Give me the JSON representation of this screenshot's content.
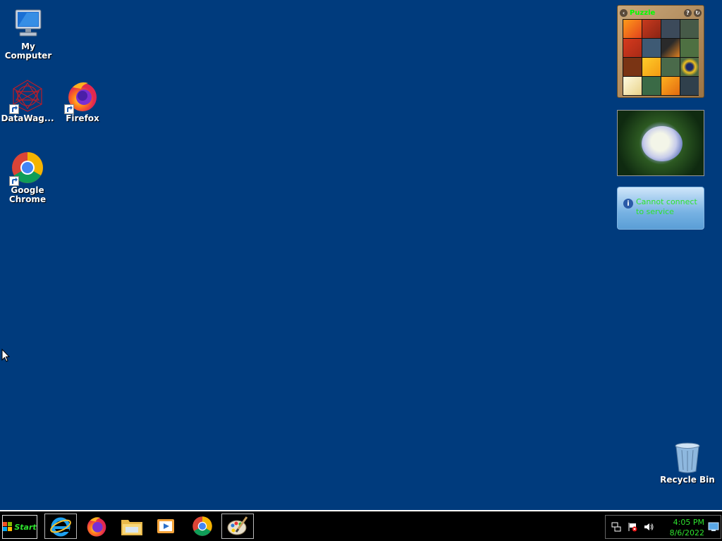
{
  "desktop": {
    "icons": [
      {
        "label": "My Computer",
        "icon": "computer-icon"
      },
      {
        "label": "DataWag...",
        "icon": "datawag-icon"
      },
      {
        "label": "Firefox",
        "icon": "firefox-icon"
      },
      {
        "label": "Google Chrome",
        "icon": "chrome-icon"
      },
      {
        "label": "Recycle Bin",
        "icon": "recycle-bin-icon"
      }
    ]
  },
  "gadgets": {
    "puzzle": {
      "title": "Puzzle"
    },
    "weather": {
      "message": "Cannot connect to service"
    }
  },
  "taskbar": {
    "start_label": "Start",
    "pinned": [
      "internet-explorer-icon",
      "firefox-icon",
      "file-explorer-icon",
      "media-player-icon",
      "chrome-icon",
      "paint-icon"
    ],
    "clock": {
      "time": "4:05 PM",
      "date": "8/6/2022"
    }
  },
  "colors": {
    "desktop_bg": "#003b7d",
    "clock_text": "#2ee32e",
    "taskbar_bg": "#000000"
  }
}
